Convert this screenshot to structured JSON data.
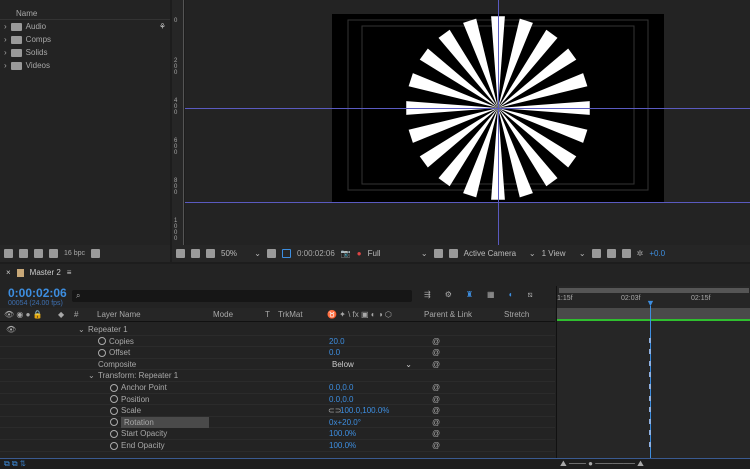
{
  "project": {
    "column_name": "Name",
    "folders": [
      "Audio",
      "Comps",
      "Solids",
      "Videos"
    ],
    "bpc": "16 bpc"
  },
  "viewer": {
    "zoom": "50%",
    "timecode": "0:00:02:06",
    "resolution": "Full",
    "camera": "Active Camera",
    "views": "1 View",
    "exposure": "+0.0",
    "ruler_labels": [
      "0",
      "200",
      "400",
      "600",
      "800",
      "1000"
    ],
    "copies": 20
  },
  "timeline": {
    "comp_tab": "Master 2",
    "timecode": "0:00:02:06",
    "frame_info": "00054 (24.00 fps)",
    "search_placeholder": "⌕",
    "columns": {
      "num": "#",
      "layer_name": "Layer Name",
      "mode": "Mode",
      "t": "T",
      "trkmat": "TrkMat",
      "switches": "♉ ✦ \\ fx ▣ ◐ ◑ ⬡",
      "parent": "Parent & Link",
      "stretch": "Stretch"
    },
    "ruler": [
      "1:15f",
      "02:03f",
      "02:15f"
    ],
    "rows": [
      {
        "label": "Repeater 1",
        "indent": 1,
        "type": "group"
      },
      {
        "label": "Copies",
        "value": "20.0",
        "indent": 2,
        "sw": true
      },
      {
        "label": "Offset",
        "value": "0.0",
        "indent": 2,
        "sw": true
      },
      {
        "label": "Composite",
        "dropdown": "Below",
        "indent": 2
      },
      {
        "label": "Transform: Repeater 1",
        "indent": 2,
        "type": "group"
      },
      {
        "label": "Anchor Point",
        "value": "0.0,0.0",
        "indent": 3,
        "sw": true
      },
      {
        "label": "Position",
        "value": "0.0,0.0",
        "indent": 3,
        "sw": true
      },
      {
        "label": "Scale",
        "value": "100.0,100.0%",
        "indent": 3,
        "sw": true,
        "link": true
      },
      {
        "label": "Rotation",
        "value": "0x+20.0°",
        "indent": 3,
        "sw": true,
        "selected": true
      },
      {
        "label": "Start Opacity",
        "value": "100.0%",
        "indent": 3,
        "sw": true
      },
      {
        "label": "End Opacity",
        "value": "100.0%",
        "indent": 3,
        "sw": true
      }
    ]
  },
  "colors": {
    "accent": "#3d8ee0",
    "guide": "#5a5ac0",
    "green": "#2fbf2f"
  }
}
